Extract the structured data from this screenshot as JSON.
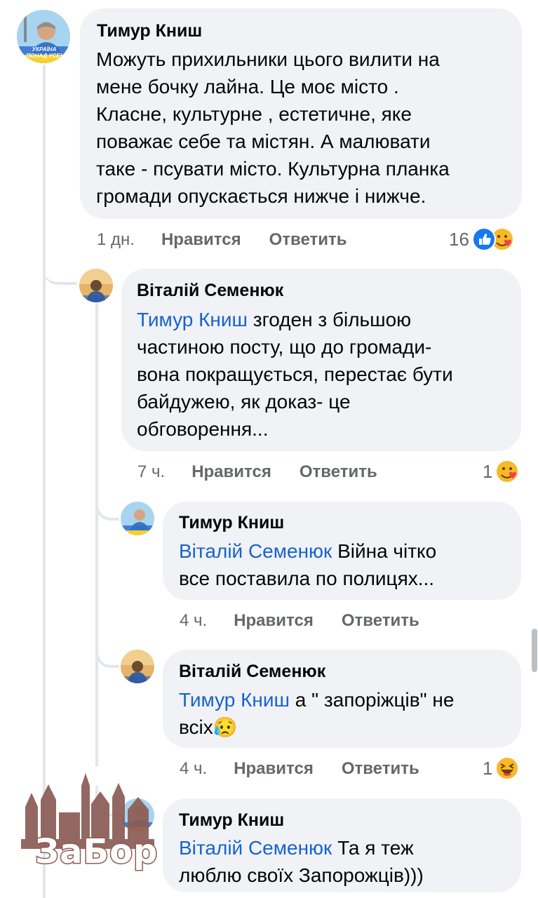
{
  "comments": [
    {
      "author": "Тимур Книш",
      "lines": [
        "Можуть прихильники цього вилити на",
        "мене бочку лайна. Це моє місто .",
        "Класне, культурне , естетичне, яке",
        "поважає себе та містян. А малювати",
        "таке  - псувати місто. Культурна планка",
        "громади опускається нижче і нижче."
      ],
      "time": "1 дн.",
      "like_label": "Нравится",
      "reply_label": "Ответить",
      "reaction_count": "16",
      "reaction_icons": [
        "like-icon",
        "care-icon"
      ]
    },
    {
      "author": "Віталій Семенюк",
      "mention": "Тимур Книш",
      "lines": [
        " згоден з більшою",
        "частиною  посту, що до громади-",
        "вона покращується, перестає бути",
        "байдужею, як доказ- це",
        "обговорення..."
      ],
      "time": "7 ч.",
      "like_label": "Нравится",
      "reply_label": "Ответить",
      "reaction_count": "1",
      "reaction_icons": [
        "care-icon"
      ]
    },
    {
      "author": "Тимур Книш",
      "mention": "Віталій Семенюк",
      "lines": [
        " Війна чітко",
        "все поставила по полицях..."
      ],
      "time": "4 ч.",
      "like_label": "Нравится",
      "reply_label": "Ответить"
    },
    {
      "author": "Віталій Семенюк",
      "mention": "Тимур Книш",
      "lines": [
        " а \" запоріжців\" не",
        "всіх"
      ],
      "emoji": "😥",
      "time": "4 ч.",
      "like_label": "Нравится",
      "reply_label": "Ответить",
      "reaction_count": "1",
      "reaction_icons": [
        "haha-icon"
      ]
    },
    {
      "author": "Тимур Книш",
      "mention": "Віталій Семенюк",
      "lines": [
        " Та я теж",
        "люблю своїх Запорожців)))"
      ]
    }
  ],
  "avatar_badge_text": [
    "УКРАЇНА",
    "ПОНАД УСЕ!"
  ],
  "watermark": {
    "text": "ЗаБор",
    "icon": "city-skyline-icon"
  },
  "colors": {
    "bubble": "#f0f2f5",
    "mention": "#1763cf",
    "meta": "#65676b",
    "like": "#1877f2",
    "reaction_yellow": "#f7b928"
  }
}
